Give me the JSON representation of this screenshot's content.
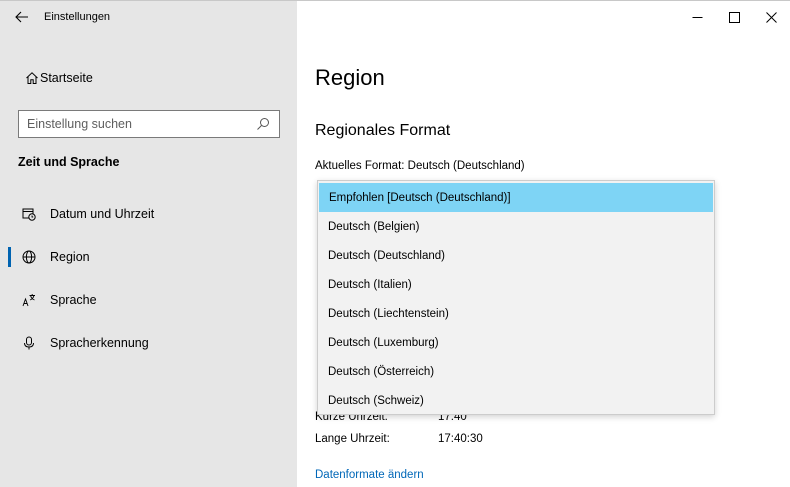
{
  "window": {
    "title": "Einstellungen",
    "controls": {
      "minimize": "—",
      "maximize": "☐",
      "close": "✕"
    }
  },
  "sidebar": {
    "home_label": "Startseite",
    "search_placeholder": "Einstellung suchen",
    "section_title": "Zeit und Sprache",
    "items": [
      {
        "label": "Datum und Uhrzeit",
        "icon": "calendar-clock-icon",
        "selected": false
      },
      {
        "label": "Region",
        "icon": "globe-icon",
        "selected": true
      },
      {
        "label": "Sprache",
        "icon": "language-icon",
        "selected": false
      },
      {
        "label": "Spracherkennung",
        "icon": "microphone-icon",
        "selected": false
      }
    ]
  },
  "main": {
    "title": "Region",
    "subtitle": "Regionales Format",
    "current_format": "Aktuelles Format: Deutsch (Deutschland)",
    "rows": [
      {
        "key": "Kurze Uhrzeit:",
        "value": "17:40"
      },
      {
        "key": "Lange Uhrzeit:",
        "value": "17:40:30"
      }
    ],
    "link": "Datenformate ändern"
  },
  "dropdown": {
    "options": [
      "Empfohlen [Deutsch (Deutschland)]",
      "Deutsch (Belgien)",
      "Deutsch (Deutschland)",
      "Deutsch (Italien)",
      "Deutsch (Liechtenstein)",
      "Deutsch (Luxemburg)",
      "Deutsch (Österreich)",
      "Deutsch (Schweiz)"
    ],
    "highlighted_index": 0
  },
  "colors": {
    "sidebar_bg": "#e6e6e6",
    "accent": "#0063b1",
    "highlight": "#7ed4f5",
    "link": "#0067b8"
  }
}
